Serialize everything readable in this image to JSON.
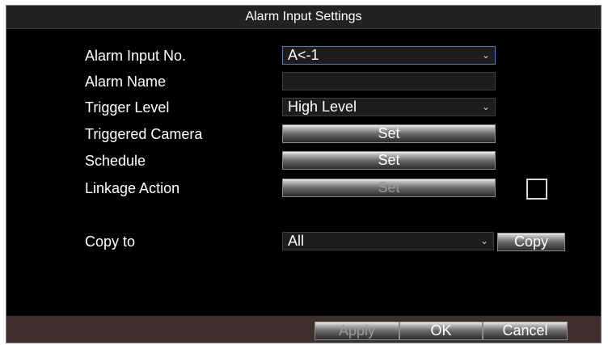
{
  "dialog": {
    "title": "Alarm Input Settings"
  },
  "form": {
    "alarm_input_no": {
      "label": "Alarm Input No.",
      "value": "A<-1"
    },
    "alarm_name": {
      "label": "Alarm Name",
      "value": ""
    },
    "trigger_level": {
      "label": "Trigger Level",
      "value": "High Level"
    },
    "triggered_camera": {
      "label": "Triggered Camera",
      "button": "Set"
    },
    "schedule": {
      "label": "Schedule",
      "button": "Set"
    },
    "linkage_action": {
      "label": "Linkage Action",
      "button": "Set",
      "enabled": false,
      "checked": false
    },
    "copy_to": {
      "label": "Copy to",
      "value": "All",
      "button": "Copy"
    }
  },
  "footer": {
    "apply": "Apply",
    "ok": "OK",
    "cancel": "Cancel"
  },
  "icons": {
    "dropdown": "chevron-down-icon"
  }
}
